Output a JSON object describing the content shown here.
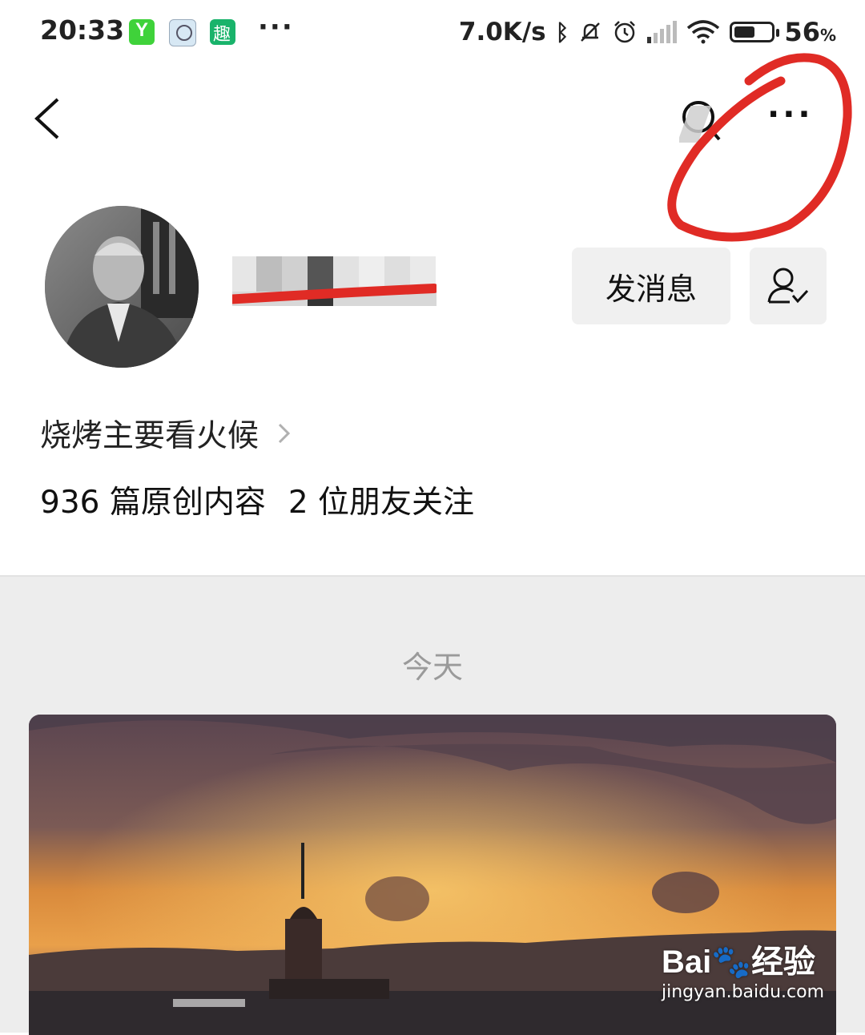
{
  "status_bar": {
    "time": "20:33",
    "net_speed": "7.0K/s",
    "battery_value": "56",
    "battery_unit": "%",
    "battery_level": 0.56,
    "more": "···",
    "icons": [
      "app-green-icon",
      "clock-app-icon",
      "qu-app-icon",
      "bluetooth-icon",
      "bell-muted-icon",
      "alarm-icon",
      "signal-icon",
      "wifi-icon",
      "battery-icon"
    ]
  },
  "nav": {
    "more": "···"
  },
  "profile": {
    "bio": "烧烤主要看火候",
    "stats": {
      "original": "936 篇原创内容",
      "friends": "2 位朋友关注"
    },
    "send_message": "发消息"
  },
  "feed": {
    "date_label": "今天"
  },
  "watermark": {
    "brand": "Bai",
    "brand_cn": "经验",
    "url": "jingyan.baidu.com"
  },
  "colors": {
    "annotation_red": "#e02b25",
    "feed_bg": "#ededed",
    "button_bg": "#f0f0f0"
  }
}
